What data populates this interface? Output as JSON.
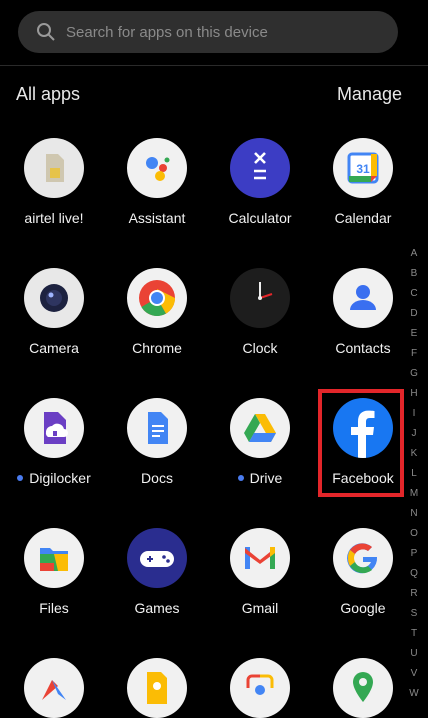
{
  "search": {
    "placeholder": "Search for apps on this device"
  },
  "header": {
    "title": "All apps",
    "manage_label": "Manage"
  },
  "apps": [
    {
      "label": "airtel live!",
      "icon": "sim-card-icon",
      "dot": false
    },
    {
      "label": "Assistant",
      "icon": "assistant-icon",
      "dot": false
    },
    {
      "label": "Calculator",
      "icon": "calculator-icon",
      "dot": false
    },
    {
      "label": "Calendar",
      "icon": "calendar-icon",
      "dot": false,
      "day": "31"
    },
    {
      "label": "Camera",
      "icon": "camera-icon",
      "dot": false
    },
    {
      "label": "Chrome",
      "icon": "chrome-icon",
      "dot": false
    },
    {
      "label": "Clock",
      "icon": "clock-icon",
      "dot": false
    },
    {
      "label": "Contacts",
      "icon": "contacts-icon",
      "dot": false
    },
    {
      "label": "Digilocker",
      "icon": "digilocker-icon",
      "dot": true
    },
    {
      "label": "Docs",
      "icon": "docs-icon",
      "dot": false
    },
    {
      "label": "Drive",
      "icon": "drive-icon",
      "dot": true
    },
    {
      "label": "Facebook",
      "icon": "facebook-icon",
      "dot": false,
      "highlighted": true
    },
    {
      "label": "Files",
      "icon": "files-icon",
      "dot": false
    },
    {
      "label": "Games",
      "icon": "gamepad-icon",
      "dot": false
    },
    {
      "label": "Gmail",
      "icon": "gmail-icon",
      "dot": false
    },
    {
      "label": "Google",
      "icon": "google-icon",
      "dot": false
    },
    {
      "label": "",
      "icon": "google-pay-icon",
      "dot": false
    },
    {
      "label": "",
      "icon": "keep-notes-icon",
      "dot": false
    },
    {
      "label": "",
      "icon": "lens-icon",
      "dot": false
    },
    {
      "label": "",
      "icon": "maps-icon",
      "dot": false
    }
  ],
  "alphabet": [
    "A",
    "B",
    "C",
    "D",
    "E",
    "F",
    "G",
    "H",
    "I",
    "J",
    "K",
    "L",
    "M",
    "N",
    "O",
    "P",
    "Q",
    "R",
    "S",
    "T",
    "U",
    "V",
    "W"
  ],
  "colors": {
    "background": "#000000",
    "search_bg": "#2f2f2f",
    "highlight": "#e3262a",
    "notification_dot": "#4a7cf0"
  }
}
